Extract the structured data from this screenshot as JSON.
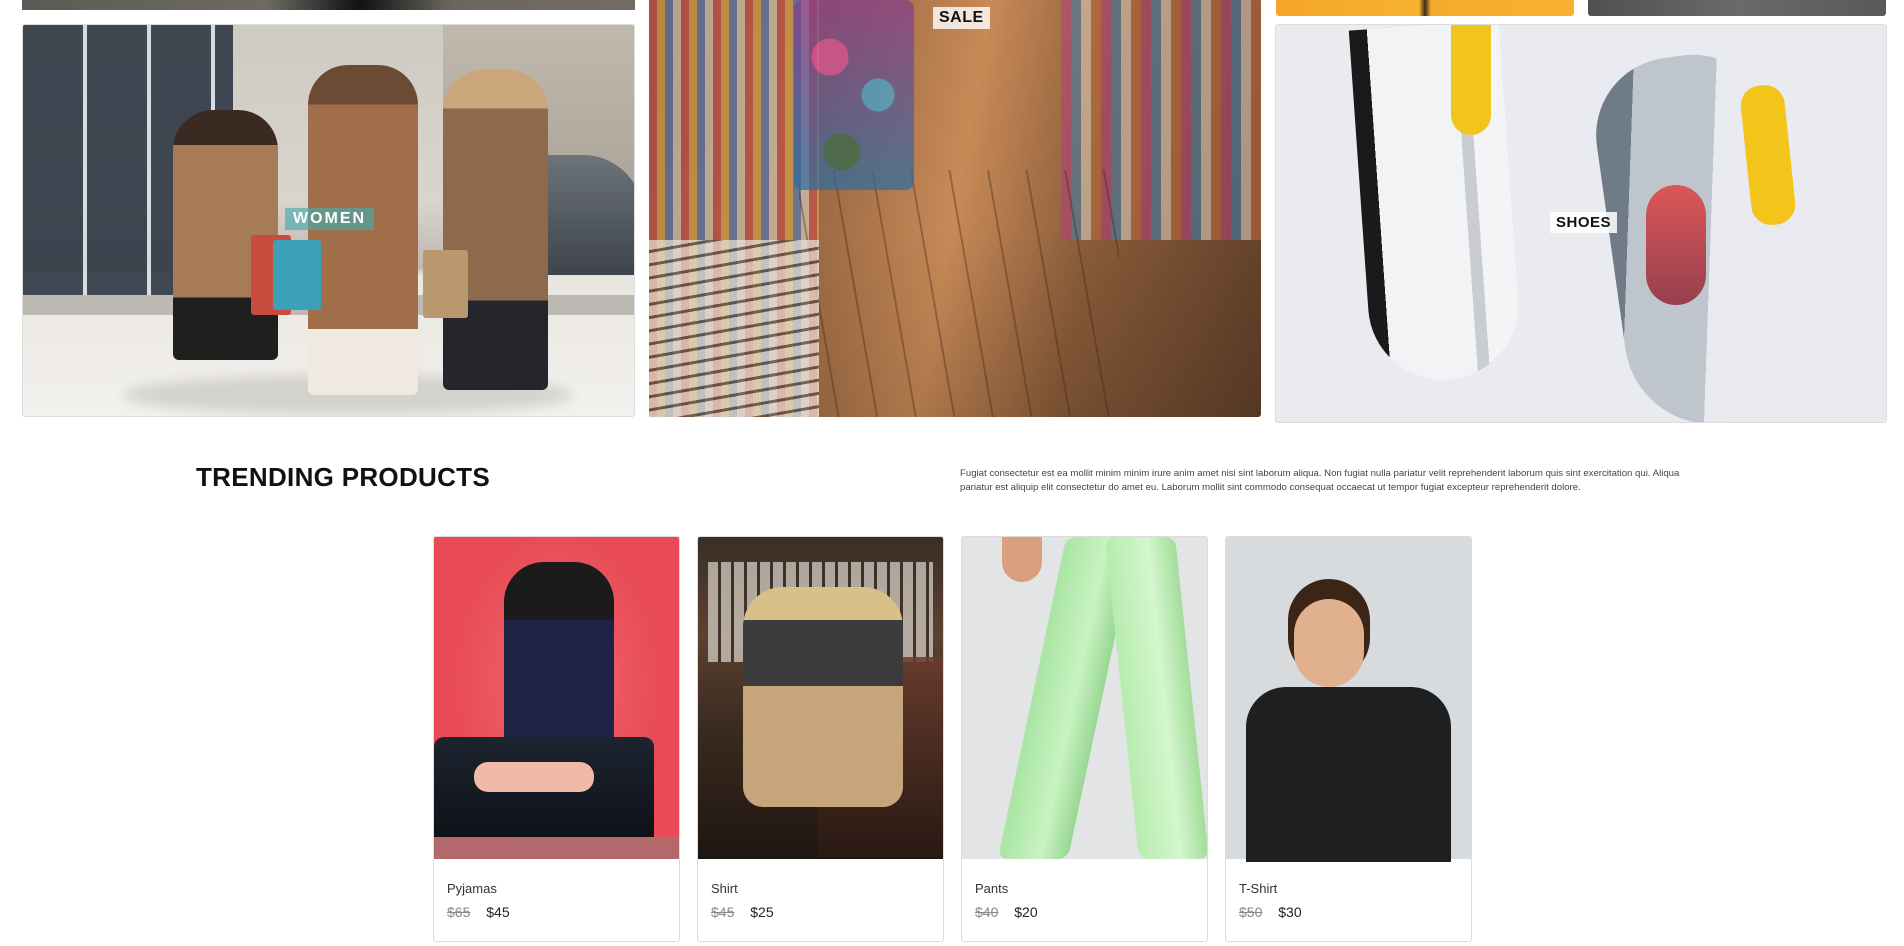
{
  "categories": {
    "women": {
      "label": "WOMEN"
    },
    "sale": {
      "label": "SALE"
    },
    "shoes": {
      "label": "SHOES"
    }
  },
  "trending": {
    "title": "TRENDING PRODUCTS",
    "description": "Fugiat consectetur est ea mollit minim minim irure anim amet nisi sint laborum aliqua. Non fugiat nulla pariatur velit reprehenderit laborum quis sint exercitation qui. Aliqua pariatur est aliquip elit consectetur do amet eu. Laborum mollit sint commodo consequat occaecat ut tempor fugiat excepteur reprehenderit dolore."
  },
  "products": [
    {
      "name": "Pyjamas",
      "old_price": "$65",
      "price": "$45"
    },
    {
      "name": "Shirt",
      "old_price": "$45",
      "price": "$25"
    },
    {
      "name": "Pants",
      "old_price": "$40",
      "price": "$20"
    },
    {
      "name": "T-Shirt",
      "old_price": "$50",
      "price": "$30"
    }
  ]
}
